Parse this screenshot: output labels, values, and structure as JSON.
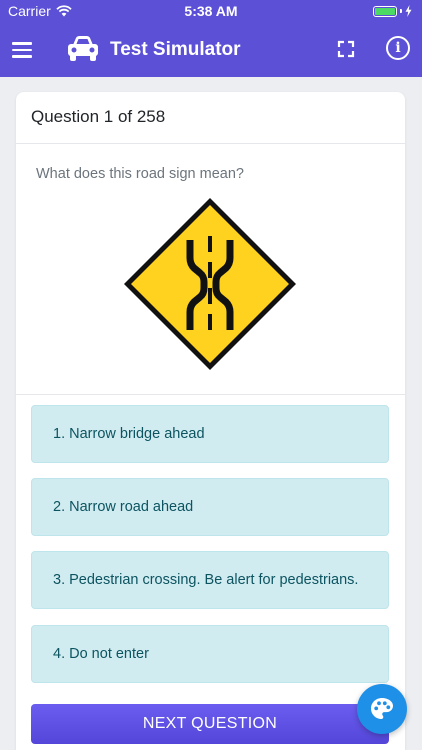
{
  "status_bar": {
    "carrier": "Carrier",
    "time": "5:38 AM",
    "battery_color": "#4cd964"
  },
  "app_bar": {
    "title": "Test Simulator",
    "menu_icon": "hamburger-menu-icon",
    "logo_icon": "car-icon",
    "fullscreen_icon": "fullscreen-icon",
    "info_icon": "info-icon",
    "info_glyph": "i",
    "color": "#5b50d6"
  },
  "question": {
    "header": "Question 1 of 258",
    "text": "What does this road sign mean?",
    "image_icon": "narrow-road-sign-icon"
  },
  "answers": [
    {
      "label": "1. Narrow bridge ahead"
    },
    {
      "label": "2. Narrow road ahead"
    },
    {
      "label": "3. Pedestrian crossing. Be alert for pedestrians."
    },
    {
      "label": "4. Do not enter"
    }
  ],
  "next_button": {
    "label": "NEXT QUESTION"
  },
  "fab": {
    "icon": "palette-icon",
    "color": "#1e90e8"
  },
  "colors": {
    "answer_bg": "#d1ecf1",
    "answer_text": "#0c5460",
    "sign_yellow": "#ffd21f"
  }
}
